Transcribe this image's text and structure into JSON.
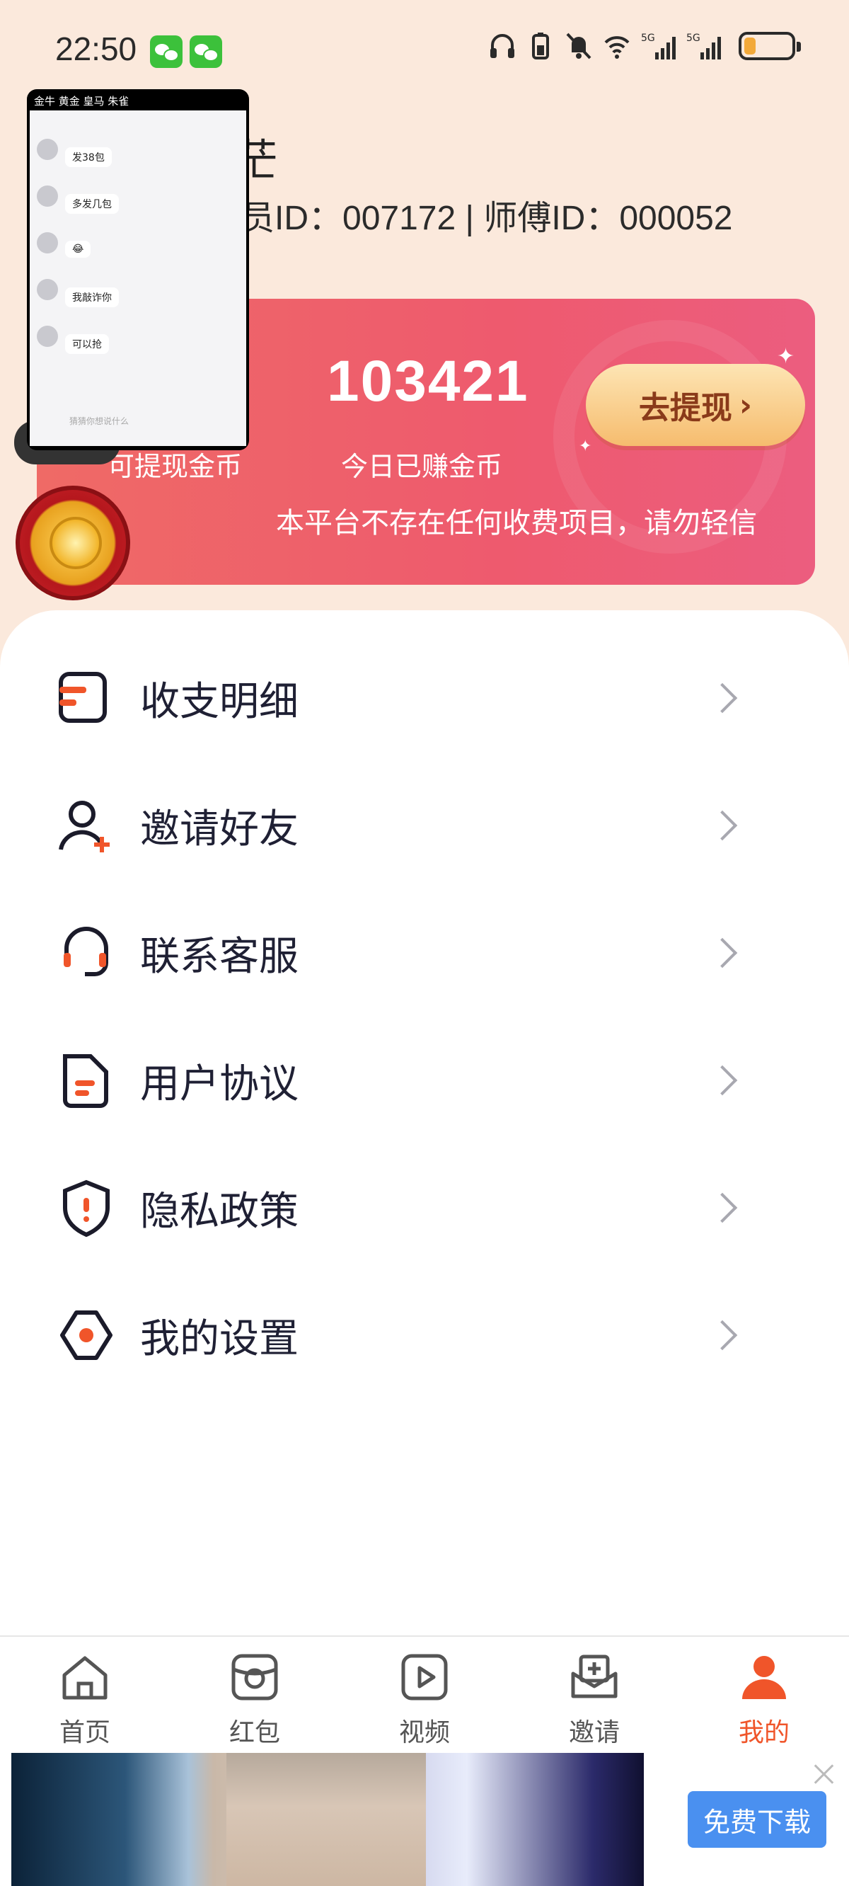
{
  "status": {
    "time": "22:50",
    "battery_level": 0.25,
    "network": [
      "5G",
      "5G"
    ]
  },
  "profile": {
    "nickname": "茫",
    "ids": "员ID：007172 | 师傅ID：000052"
  },
  "balance": {
    "coins": "103421",
    "label_withdrawable": "可提现金币",
    "label_today": "今日已赚金币",
    "withdraw_button": "去提现",
    "notice": "本平台不存在任何收费项目，请勿轻信"
  },
  "mini_window": {
    "title": "金牛 黄金 皇马 朱雀",
    "messages": [
      {
        "bubble": "发38包"
      },
      {
        "bubble": "多发几包"
      },
      {
        "bubble": "😂"
      },
      {
        "bubble": "我敲诈你"
      },
      {
        "bubble": "可以抢"
      }
    ],
    "input_placeholder": "猜猜你想说什么"
  },
  "menu": [
    {
      "label": "收支明细",
      "icon": "ledger-icon"
    },
    {
      "label": "邀请好友",
      "icon": "invite-user-icon"
    },
    {
      "label": "联系客服",
      "icon": "headset-icon"
    },
    {
      "label": "用户协议",
      "icon": "document-icon"
    },
    {
      "label": "隐私政策",
      "icon": "shield-icon"
    },
    {
      "label": "我的设置",
      "icon": "settings-icon"
    }
  ],
  "tabs": [
    {
      "label": "首页",
      "icon": "home-icon",
      "active": false
    },
    {
      "label": "红包",
      "icon": "red-packet-icon",
      "active": false
    },
    {
      "label": "视频",
      "icon": "video-icon",
      "active": false
    },
    {
      "label": "邀请",
      "icon": "invite-icon",
      "active": false
    },
    {
      "label": "我的",
      "icon": "profile-icon",
      "active": true
    }
  ],
  "ad": {
    "button": "免费下载"
  },
  "colors": {
    "accent": "#f0552a",
    "card": "#ee5f6f",
    "ad_button": "#4a90f0"
  }
}
